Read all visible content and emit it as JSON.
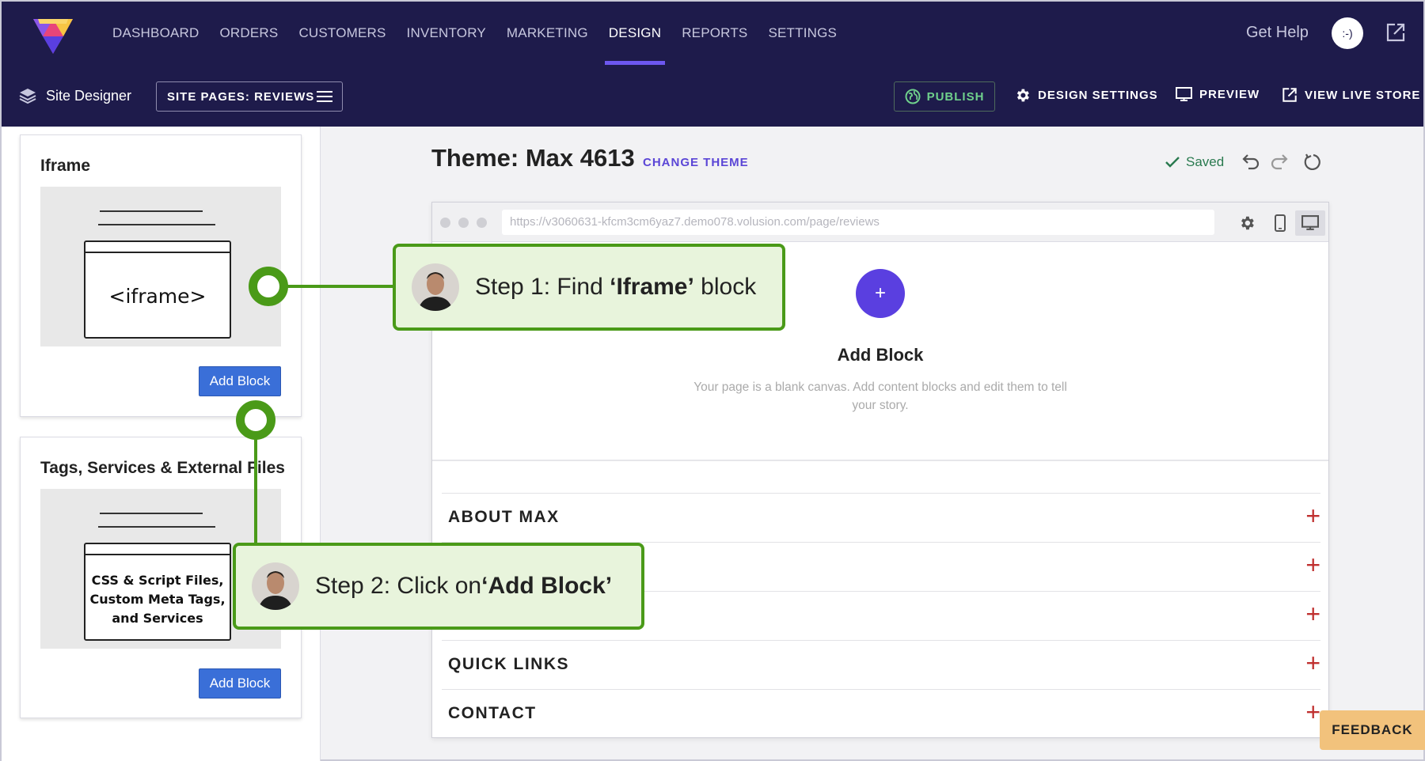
{
  "nav": {
    "items": [
      "DASHBOARD",
      "ORDERS",
      "CUSTOMERS",
      "INVENTORY",
      "MARKETING",
      "DESIGN",
      "REPORTS",
      "SETTINGS"
    ],
    "active": "DESIGN",
    "get_help": "Get Help",
    "avatar_text": ":-)"
  },
  "toolbar": {
    "site_designer": "Site Designer",
    "site_pages": "SITE PAGES: REVIEWS",
    "publish": "PUBLISH",
    "design_settings": "DESIGN SETTINGS",
    "preview": "PREVIEW",
    "view_live_store": "VIEW LIVE STORE"
  },
  "left_panel": {
    "cards": [
      {
        "title": "Iframe",
        "preview_text": "<iframe>",
        "button": "Add Block"
      },
      {
        "title": "Tags, Services & External Files",
        "preview_lines": [
          "CSS & Script Files,",
          "Custom Meta Tags,",
          "and Services"
        ],
        "button": "Add Block"
      }
    ]
  },
  "editor": {
    "theme_title": "Theme: Max 4613",
    "change_theme": "CHANGE THEME",
    "saved": "Saved",
    "url": "https://v3060631-kfcm3cm6yaz7.demo078.volusion.com/page/reviews",
    "add_block_plus": "+",
    "add_block_title": "Add Block",
    "add_block_subtitle": "Your page is a blank canvas. Add content blocks and edit them to tell your story.",
    "footer_sections": [
      "ABOUT MAX",
      "",
      "",
      "QUICK LINKS",
      "CONTACT"
    ]
  },
  "callouts": {
    "step1_prefix": "Step 1: Find ",
    "step1_bold": "‘Iframe’",
    "step1_suffix": " block",
    "step2_prefix": "Step 2:  Click on",
    "step2_bold": "‘Add Block’"
  },
  "feedback": "FEEDBACK",
  "colors": {
    "topbar": "#1e1b4b",
    "accent": "#6d57f0",
    "add_button": "#3a6fd8",
    "callout_border": "#4a9a18",
    "callout_bg": "#e8f4dc",
    "plus_red": "#c0302f"
  }
}
